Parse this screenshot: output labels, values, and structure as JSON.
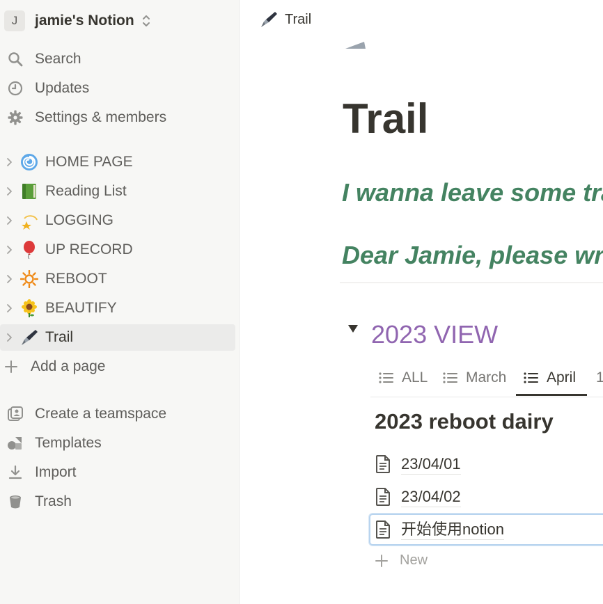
{
  "workspace": {
    "avatar_letter": "J",
    "name": "jamie's Notion"
  },
  "sidebar": {
    "top_items": [
      {
        "label": "Search",
        "icon": "search-icon"
      },
      {
        "label": "Updates",
        "icon": "clock-icon"
      },
      {
        "label": "Settings & members",
        "icon": "gear-icon"
      }
    ],
    "pages": [
      {
        "label": "HOME PAGE",
        "icon": "cyclone-emoji"
      },
      {
        "label": "Reading List",
        "icon": "green-book-emoji"
      },
      {
        "label": "LOGGING",
        "icon": "dizzy-star-emoji"
      },
      {
        "label": "UP RECORD",
        "icon": "balloon-emoji"
      },
      {
        "label": "REBOOT",
        "icon": "sun-emoji"
      },
      {
        "label": "BEAUTIFY",
        "icon": "sunflower-emoji"
      },
      {
        "label": "Trail",
        "icon": "fountain-pen-emoji"
      }
    ],
    "add_page": "Add a page",
    "bottom_items": [
      {
        "label": "Create a teamspace",
        "icon": "teamspace-icon"
      },
      {
        "label": "Templates",
        "icon": "templates-icon"
      },
      {
        "label": "Import",
        "icon": "import-icon"
      },
      {
        "label": "Trash",
        "icon": "trash-icon"
      }
    ]
  },
  "topbar": {
    "breadcrumb": "Trail"
  },
  "page": {
    "title": "Trail",
    "quote_1": "I wanna leave some tra",
    "quote_2": "Dear Jamie, please writ",
    "toggle_heading": "2023 VIEW",
    "tabs": [
      {
        "label": "ALL"
      },
      {
        "label": "March"
      },
      {
        "label": "April",
        "active": true
      },
      {
        "label": "1"
      }
    ],
    "group_title": "2023 reboot dairy",
    "items": [
      "23/04/01",
      "23/04/02",
      "开始使用notion"
    ],
    "new_label": "New"
  },
  "colors": {
    "quote": "#448361",
    "toggle_heading": "#9065b0",
    "sidebar_bg": "#f7f7f5",
    "selection_border": "#b8d4ef"
  }
}
